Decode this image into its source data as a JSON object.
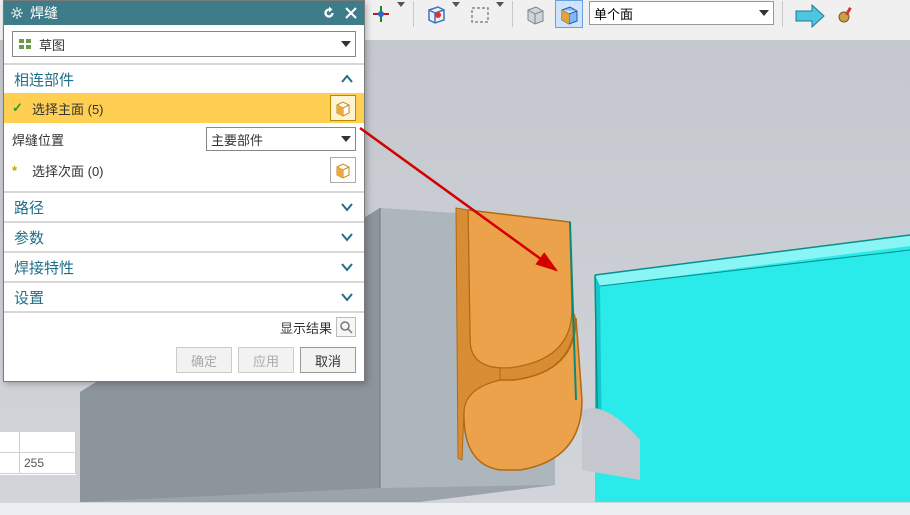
{
  "toolbar": {
    "face_filter": "单个面"
  },
  "panel": {
    "title": "焊缝",
    "mode_label": "草图",
    "sections": {
      "connected": {
        "title": "相连部件",
        "select_main": "选择主面 (5)",
        "weld_pos_label": "焊缝位置",
        "weld_pos_value": "主要部件",
        "select_sub": "选择次面 (0)"
      },
      "path": "路径",
      "params": "参数",
      "weld_props": "焊接特性",
      "settings": "设置"
    },
    "show_result": "显示结果",
    "buttons": {
      "ok": "确定",
      "apply": "应用",
      "cancel": "取消"
    }
  },
  "left_strip": {
    "value": "255"
  }
}
